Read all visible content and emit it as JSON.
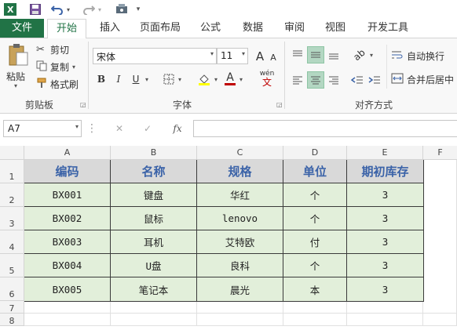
{
  "colors": {
    "accent": "#217346",
    "header_fill": "#d9d9d9",
    "header_text": "#3b63a8",
    "body_fill": "#e2efda"
  },
  "qat": {
    "icons": [
      "excel-icon",
      "save-icon",
      "undo-icon",
      "redo-icon",
      "touch-mode-icon",
      "customize-icon"
    ]
  },
  "tabs": [
    {
      "label": "文件"
    },
    {
      "label": "开始"
    },
    {
      "label": "插入"
    },
    {
      "label": "页面布局"
    },
    {
      "label": "公式"
    },
    {
      "label": "数据"
    },
    {
      "label": "审阅"
    },
    {
      "label": "视图"
    },
    {
      "label": "开发工具"
    }
  ],
  "ribbon": {
    "clipboard": {
      "paste": "粘贴",
      "cut": "剪切",
      "copy": "复制",
      "format_painter": "格式刷",
      "label": "剪贴板"
    },
    "font": {
      "name": "宋体",
      "size": "11",
      "label": "字体",
      "bold": "B",
      "italic": "I",
      "underline": "U",
      "grow": "A",
      "shrink": "A",
      "font_color": "A",
      "phonetic": "wén"
    },
    "alignment": {
      "wrap": "自动换行",
      "merge": "合并后居中",
      "label": "对齐方式"
    }
  },
  "formula_bar": {
    "name_box": "A7",
    "cancel": "✕",
    "enter": "✓",
    "fx": "fx",
    "value": ""
  },
  "grid": {
    "columns": [
      "A",
      "B",
      "C",
      "D",
      "E",
      "F"
    ],
    "rows": [
      "1",
      "2",
      "3",
      "4",
      "5",
      "6",
      "7",
      "8"
    ],
    "table": {
      "headers": [
        "编码",
        "名称",
        "规格",
        "单位",
        "期初库存"
      ],
      "rows": [
        [
          "BX001",
          "键盘",
          "华红",
          "个",
          "3"
        ],
        [
          "BX002",
          "鼠标",
          "lenovo",
          "个",
          "3"
        ],
        [
          "BX003",
          "耳机",
          "艾特欧",
          "付",
          "3"
        ],
        [
          "BX004",
          "U盘",
          "良科",
          "个",
          "3"
        ],
        [
          "BX005",
          "笔记本",
          "晨光",
          "本",
          "3"
        ]
      ]
    }
  }
}
